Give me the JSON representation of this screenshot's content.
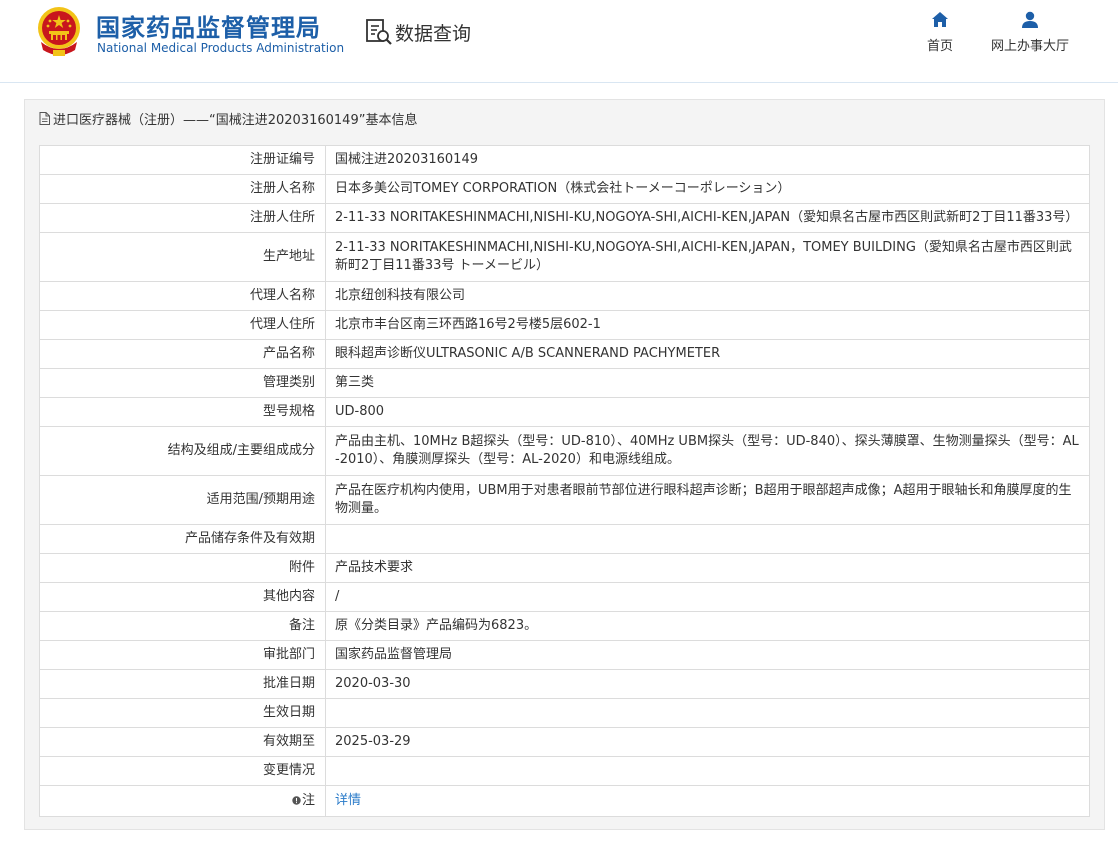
{
  "header": {
    "org_cn": "国家药品监督管理局",
    "org_en": "National Medical Products Administration",
    "query_label": "数据查询",
    "nav": {
      "home": "首页",
      "office": "网上办事大厅"
    }
  },
  "panel": {
    "title": "进口医疗器械（注册）——“国械注进20203160149”基本信息"
  },
  "rows": [
    {
      "label": "注册证编号",
      "value": "国械注进20203160149"
    },
    {
      "label": "注册人名称",
      "value": "日本多美公司TOMEY CORPORATION（株式会社トーメーコーポレーション）"
    },
    {
      "label": "注册人住所",
      "value": "2-11-33 NORITAKESHINMACHI,NISHI-KU,NOGOYA-SHI,AICHI-KEN,JAPAN（愛知県名古屋市西区則武新町2丁目11番33号）"
    },
    {
      "label": "生产地址",
      "value": "2-11-33 NORITAKESHINMACHI,NISHI-KU,NOGOYA-SHI,AICHI-KEN,JAPAN，TOMEY BUILDING（愛知県名古屋市西区則武新町2丁目11番33号 トーメービル）"
    },
    {
      "label": "代理人名称",
      "value": "北京纽创科技有限公司"
    },
    {
      "label": "代理人住所",
      "value": "北京市丰台区南三环西路16号2号楼5层602-1"
    },
    {
      "label": "产品名称",
      "value": "眼科超声诊断仪ULTRASONIC A/B SCANNERAND PACHYMETER"
    },
    {
      "label": "管理类别",
      "value": "第三类"
    },
    {
      "label": "型号规格",
      "value": "UD-800"
    },
    {
      "label": "结构及组成/主要组成成分",
      "value": "产品由主机、10MHz B超探头（型号：UD-810）、40MHz UBM探头（型号：UD-840）、探头薄膜罩、生物测量探头（型号：AL-2010）、角膜测厚探头（型号：AL-2020）和电源线组成。"
    },
    {
      "label": "适用范围/预期用途",
      "value": "产品在医疗机构内使用，UBM用于对患者眼前节部位进行眼科超声诊断；B超用于眼部超声成像；A超用于眼轴长和角膜厚度的生物测量。"
    },
    {
      "label": "产品储存条件及有效期",
      "value": ""
    },
    {
      "label": "附件",
      "value": "产品技术要求"
    },
    {
      "label": "其他内容",
      "value": "/"
    },
    {
      "label": "备注",
      "value": "原《分类目录》产品编码为6823。"
    },
    {
      "label": "审批部门",
      "value": "国家药品监督管理局"
    },
    {
      "label": "批准日期",
      "value": "2020-03-30"
    },
    {
      "label": "生效日期",
      "value": ""
    },
    {
      "label": "有效期至",
      "value": "2025-03-29"
    },
    {
      "label": "变更情况",
      "value": ""
    },
    {
      "label": "注",
      "value": "详情"
    }
  ],
  "colors": {
    "brand": "#1d5fa8",
    "link": "#2a7bc9",
    "emblem_red": "#c8161d",
    "emblem_gold": "#f2c318"
  },
  "icons": [
    "national-emblem-icon",
    "data-query-icon",
    "home-icon",
    "user-icon",
    "document-icon",
    "note-icon"
  ]
}
